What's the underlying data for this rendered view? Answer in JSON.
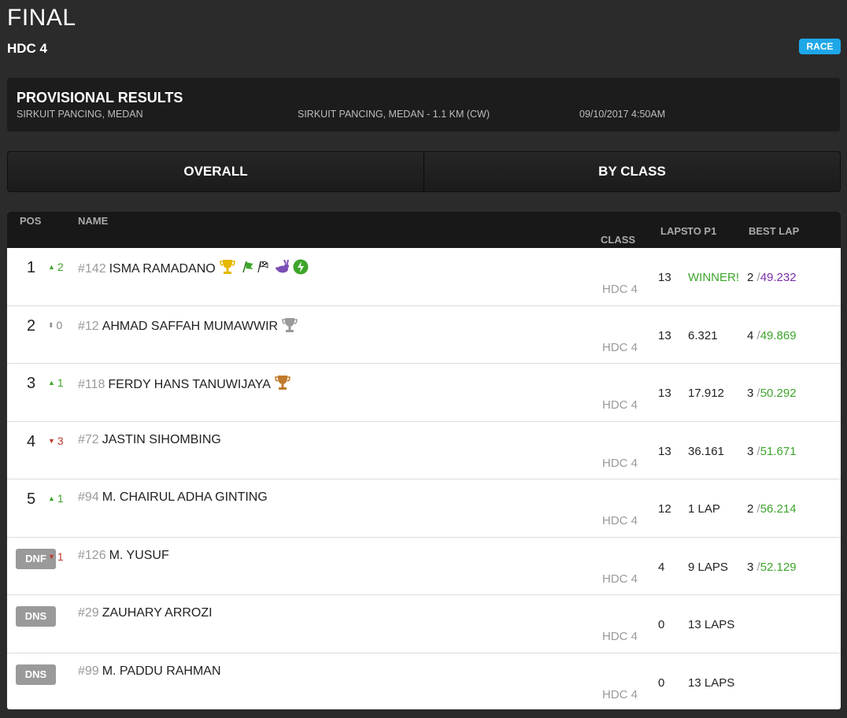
{
  "header": {
    "title": "FINAL",
    "subtitle": "HDC 4",
    "session_badge": "RACE"
  },
  "provisional": {
    "title": "PROVISIONAL RESULTS",
    "location": "SIRKUIT PANCING, MEDAN",
    "track": "SIRKUIT PANCING, MEDAN - 1.1 KM (CW)",
    "datetime": "09/10/2017 4:50AM"
  },
  "tabs": [
    {
      "label": "OVERALL"
    },
    {
      "label": "BY CLASS"
    }
  ],
  "columns": {
    "pos": "POS",
    "name": "NAME",
    "class": "CLASS",
    "laps": "LAPS",
    "to_p1": "TO P1",
    "best_lap": "BEST LAP"
  },
  "rows": [
    {
      "pos": "1",
      "delta": "2",
      "delta_dir": "up",
      "num": "#142",
      "name": "ISMA RAMADANO",
      "icons": [
        "gold-trophy-icon",
        "green-flag-icon",
        "checkered-flag-icon",
        "rabbit-icon",
        "lightning-icon"
      ],
      "class": "HDC 4",
      "laps": "13",
      "to_p1": "WINNER!",
      "best_lap_no": "2",
      "best_lap_time": "49.232",
      "best_color": "purple"
    },
    {
      "pos": "2",
      "delta": "0",
      "delta_dir": "same",
      "num": "#12",
      "name": "AHMAD SAFFAH MUMAWWIR",
      "icons": [
        "silver-trophy-icon"
      ],
      "class": "HDC 4",
      "laps": "13",
      "to_p1": "6.321",
      "best_lap_no": "4",
      "best_lap_time": "49.869",
      "best_color": "green"
    },
    {
      "pos": "3",
      "delta": "1",
      "delta_dir": "up",
      "num": "#118",
      "name": "FERDY HANS TANUWIJAYA",
      "icons": [
        "bronze-trophy-icon"
      ],
      "class": "HDC 4",
      "laps": "13",
      "to_p1": "17.912",
      "best_lap_no": "3",
      "best_lap_time": "50.292",
      "best_color": "green"
    },
    {
      "pos": "4",
      "delta": "3",
      "delta_dir": "down",
      "num": "#72",
      "name": "JASTIN SIHOMBING",
      "icons": [],
      "class": "HDC 4",
      "laps": "13",
      "to_p1": "36.161",
      "best_lap_no": "3",
      "best_lap_time": "51.671",
      "best_color": "green"
    },
    {
      "pos": "5",
      "delta": "1",
      "delta_dir": "up",
      "num": "#94",
      "name": "M. CHAIRUL ADHA GINTING",
      "icons": [],
      "class": "HDC 4",
      "laps": "12",
      "to_p1": "1 LAP",
      "best_lap_no": "2",
      "best_lap_time": "56.214",
      "best_color": "green"
    },
    {
      "status": "DNF",
      "delta": "1",
      "delta_dir": "down",
      "num": "#126",
      "name": "M. YUSUF",
      "icons": [],
      "class": "HDC 4",
      "laps": "4",
      "to_p1": "9 LAPS",
      "best_lap_no": "3",
      "best_lap_time": "52.129",
      "best_color": "green"
    },
    {
      "status": "DNS",
      "num": "#29",
      "name": "ZAUHARY ARROZI",
      "icons": [],
      "class": "HDC 4",
      "laps": "0",
      "to_p1": "13 LAPS"
    },
    {
      "status": "DNS",
      "num": "#99",
      "name": "M. PADDU RAHMAN",
      "icons": [],
      "class": "HDC 4",
      "laps": "0",
      "to_p1": "13 LAPS"
    }
  ],
  "colors": {
    "badge_blue": "#1ea7e8",
    "gain_green": "#3da52a",
    "loss_red": "#c0392b",
    "fastest_purple": "#7b2ea8",
    "gold": "#e6b800",
    "silver": "#9a9a9a",
    "bronze": "#c27a2c"
  }
}
